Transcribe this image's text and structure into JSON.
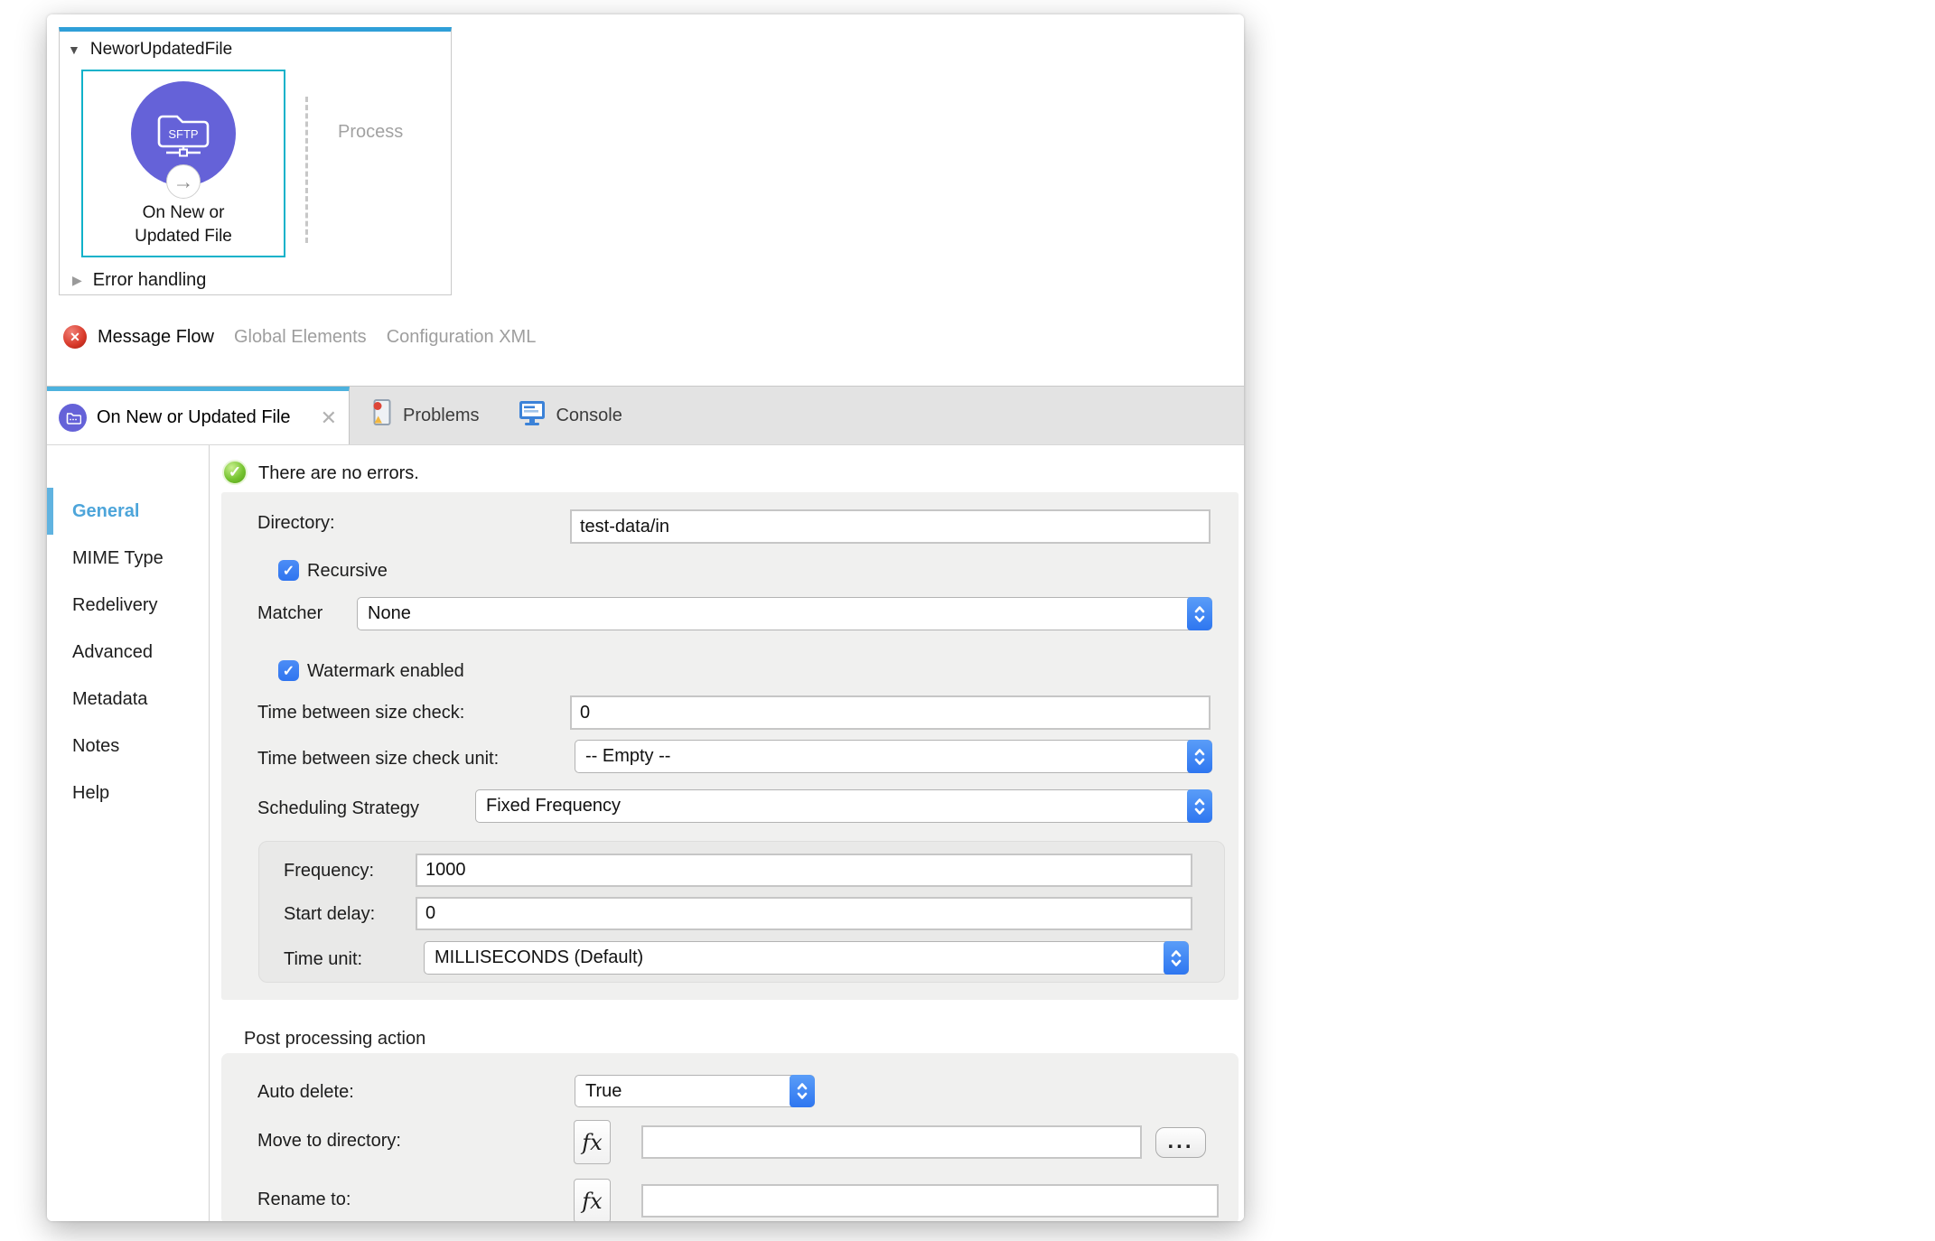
{
  "canvas": {
    "flow_name": "NeworUpdatedFile",
    "node": {
      "badge": "SFTP",
      "label": "On New or Updated File"
    },
    "process_label": "Process",
    "error_handling_label": "Error handling",
    "views": [
      {
        "label": "Message Flow",
        "active": true,
        "has_error_badge": true
      },
      {
        "label": "Global Elements",
        "active": false
      },
      {
        "label": "Configuration XML",
        "active": false
      }
    ]
  },
  "editor_tabs": [
    {
      "label": "On New or Updated File",
      "active": true,
      "closable": true
    },
    {
      "label": "Problems",
      "active": false
    },
    {
      "label": "Console",
      "active": false
    }
  ],
  "sidebar": {
    "items": [
      {
        "label": "General",
        "active": true
      },
      {
        "label": "MIME Type",
        "active": false
      },
      {
        "label": "Redelivery",
        "active": false
      },
      {
        "label": "Advanced",
        "active": false
      },
      {
        "label": "Metadata",
        "active": false
      },
      {
        "label": "Notes",
        "active": false
      },
      {
        "label": "Help",
        "active": false
      }
    ]
  },
  "form": {
    "status_message": "There are no errors.",
    "directory": {
      "label": "Directory:",
      "value": "test-data/in"
    },
    "recursive": {
      "label": "Recursive",
      "checked": true
    },
    "matcher": {
      "label": "Matcher",
      "value": "None"
    },
    "watermark": {
      "label": "Watermark enabled",
      "checked": true
    },
    "time_between_size_check": {
      "label": "Time between size check:",
      "value": "0"
    },
    "time_between_size_check_unit": {
      "label": "Time between size check unit:",
      "value": "-- Empty --"
    },
    "scheduling_strategy": {
      "label": "Scheduling Strategy",
      "value": "Fixed Frequency"
    },
    "frequency": {
      "label": "Frequency:",
      "value": "1000"
    },
    "start_delay": {
      "label": "Start delay:",
      "value": "0"
    },
    "time_unit": {
      "label": "Time unit:",
      "value": "MILLISECONDS (Default)"
    },
    "post_processing_title": "Post processing action",
    "auto_delete": {
      "label": "Auto delete:",
      "value": "True"
    },
    "move_to_directory": {
      "label": "Move to directory:",
      "value": ""
    },
    "rename_to": {
      "label": "Rename to:",
      "value": ""
    },
    "fx_label": "fx",
    "browse_label": "..."
  },
  "colors": {
    "flow_border_accent": "#2f9fd8",
    "node_selection_border": "#10b2ca",
    "sftp_purple": "#6562d8",
    "tab_accent": "#4db2de",
    "sidebar_active_text": "#4da5da",
    "control_blue": "#3478f0",
    "error_red": "#d93a2b",
    "ok_green": "#76c431"
  }
}
